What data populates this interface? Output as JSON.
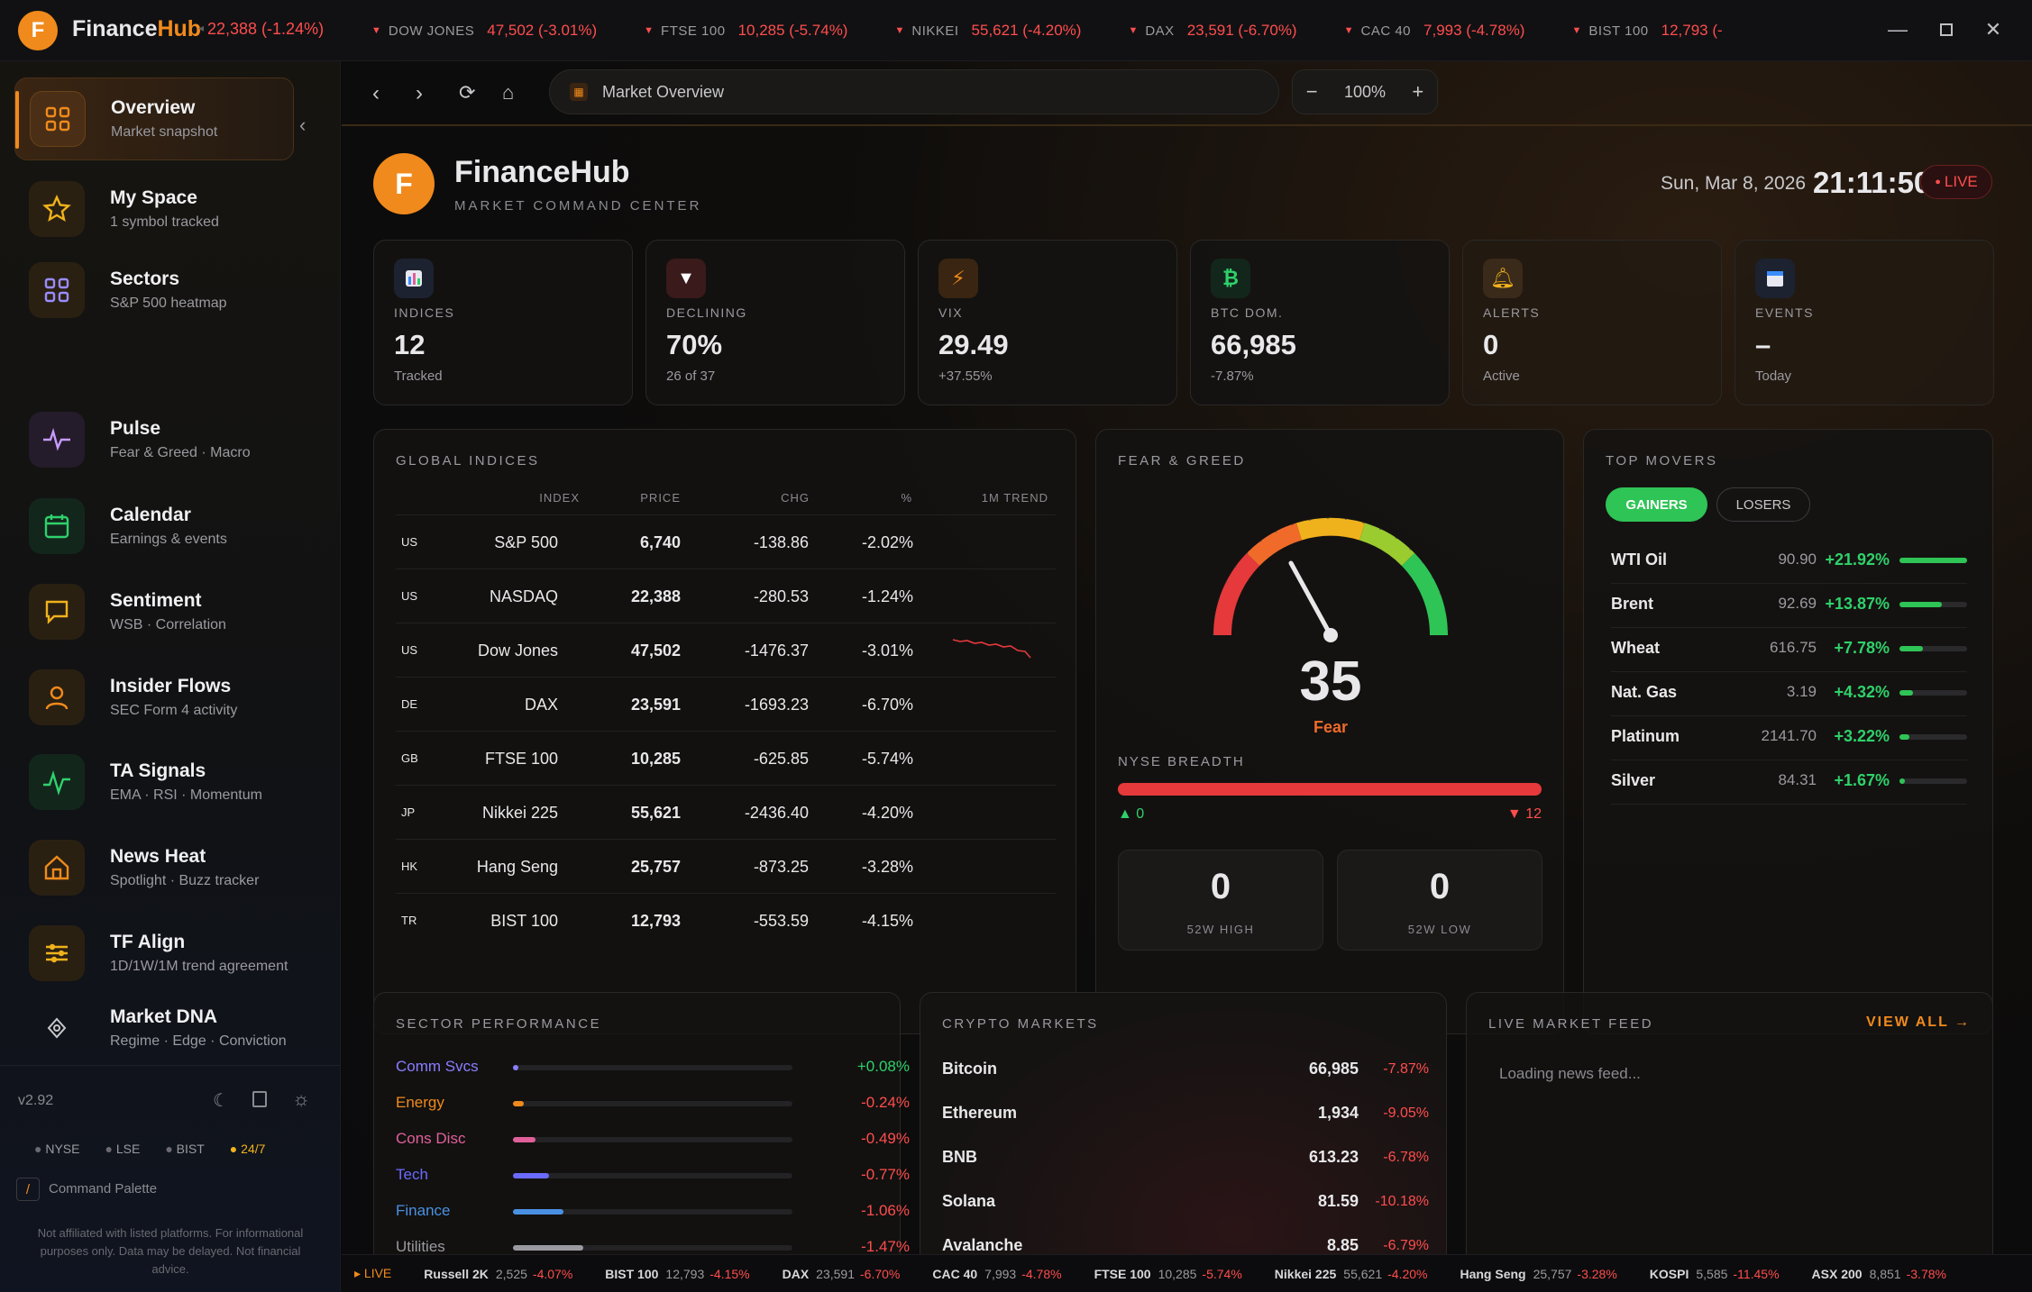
{
  "app": {
    "logo_letter": "F",
    "name_part1": "Finance",
    "name_part2": "Hub"
  },
  "ticker_first": "22,388 (-1.24%)",
  "ticker": [
    {
      "name": "DOW JONES",
      "value": "47,502 (-3.01%)"
    },
    {
      "name": "FTSE 100",
      "value": "10,285 (-5.74%)"
    },
    {
      "name": "NIKKEI",
      "value": "55,621 (-4.20%)"
    },
    {
      "name": "DAX",
      "value": "23,591 (-6.70%)"
    },
    {
      "name": "CAC 40",
      "value": "7,993 (-4.78%)"
    },
    {
      "name": "BIST 100",
      "value": "12,793 (-"
    }
  ],
  "sidebar": {
    "items": [
      {
        "title": "Overview",
        "sub": "Market snapshot"
      },
      {
        "title": "My Space",
        "sub": "1 symbol tracked"
      },
      {
        "title": "Sectors",
        "sub": "S&P 500 heatmap"
      },
      {
        "title": "Pulse",
        "sub": "Fear & Greed · Macro"
      },
      {
        "title": "Calendar",
        "sub": "Earnings & events"
      },
      {
        "title": "Sentiment",
        "sub": "WSB · Correlation"
      },
      {
        "title": "Insider Flows",
        "sub": "SEC Form 4 activity"
      },
      {
        "title": "TA Signals",
        "sub": "EMA · RSI · Momentum"
      },
      {
        "title": "News Heat",
        "sub": "Spotlight · Buzz tracker"
      },
      {
        "title": "TF Align",
        "sub": "1D/1W/1M trend agreement"
      },
      {
        "title": "Market DNA",
        "sub": "Regime · Edge · Conviction"
      }
    ],
    "version": "v2.92",
    "markets": [
      "NYSE",
      "LSE",
      "BIST",
      "24/7"
    ],
    "command_key": "/",
    "command_label": "Command Palette",
    "disclaimer": "Not affiliated with listed platforms. For informational purposes only. Data may be delayed. Not financial advice."
  },
  "browser": {
    "url": "Market Overview",
    "zoom": "100%"
  },
  "header": {
    "logo_letter": "F",
    "title": "FinanceHub",
    "subtitle": "MARKET COMMAND CENTER",
    "date": "Sun, Mar 8, 2026",
    "time": "21:11:50",
    "live": "LIVE"
  },
  "stats": [
    {
      "label": "INDICES",
      "value": "12",
      "sub": "Tracked",
      "color": "#9a9aa0"
    },
    {
      "label": "DECLINING",
      "value": "70%",
      "sub": "26 of 37",
      "color": "#ff4d4d"
    },
    {
      "label": "VIX",
      "value": "29.49",
      "sub": "+37.55%",
      "color": "#f08a1c"
    },
    {
      "label": "BTC DOM.",
      "value": "66,985",
      "sub": "-7.87%",
      "color": "#2fd16b"
    },
    {
      "label": "ALERTS",
      "value": "0",
      "sub": "Active",
      "color": "#9a9aa0"
    },
    {
      "label": "EVENTS",
      "value": "–",
      "sub": "Today",
      "color": "#9a9aa0"
    }
  ],
  "global": {
    "title": "GLOBAL INDICES",
    "headers": [
      "INDEX",
      "PRICE",
      "CHG",
      "%",
      "1M TREND"
    ],
    "rows": [
      {
        "cc": "US",
        "name": "S&P 500",
        "price": "6,740",
        "chg": "-138.86",
        "pct": "-2.02%"
      },
      {
        "cc": "US",
        "name": "NASDAQ",
        "price": "22,388",
        "chg": "-280.53",
        "pct": "-1.24%"
      },
      {
        "cc": "US",
        "name": "Dow Jones",
        "price": "47,502",
        "chg": "-1476.37",
        "pct": "-3.01%"
      },
      {
        "cc": "DE",
        "name": "DAX",
        "price": "23,591",
        "chg": "-1693.23",
        "pct": "-6.70%"
      },
      {
        "cc": "GB",
        "name": "FTSE 100",
        "price": "10,285",
        "chg": "-625.85",
        "pct": "-5.74%"
      },
      {
        "cc": "JP",
        "name": "Nikkei 225",
        "price": "55,621",
        "chg": "-2436.40",
        "pct": "-4.20%"
      },
      {
        "cc": "HK",
        "name": "Hang Seng",
        "price": "25,757",
        "chg": "-873.25",
        "pct": "-3.28%"
      },
      {
        "cc": "TR",
        "name": "BIST 100",
        "price": "12,793",
        "chg": "-553.59",
        "pct": "-4.15%"
      }
    ]
  },
  "fear": {
    "title": "FEAR & GREED",
    "value": "35",
    "label": "Fear",
    "breadth_title": "NYSE BREADTH",
    "adv": "0",
    "dec": "12",
    "high_val": "0",
    "high_lbl": "52W HIGH",
    "low_val": "0",
    "low_lbl": "52W LOW"
  },
  "movers": {
    "title": "TOP MOVERS",
    "tab_gainers": "GAINERS",
    "tab_losers": "LOSERS",
    "rows": [
      {
        "name": "WTI Oil",
        "price": "90.90",
        "pct": "+21.92%",
        "level": 1.0
      },
      {
        "name": "Brent",
        "price": "92.69",
        "pct": "+13.87%",
        "level": 0.63
      },
      {
        "name": "Wheat",
        "price": "616.75",
        "pct": "+7.78%",
        "level": 0.35
      },
      {
        "name": "Nat. Gas",
        "price": "3.19",
        "pct": "+4.32%",
        "level": 0.2
      },
      {
        "name": "Platinum",
        "price": "2141.70",
        "pct": "+3.22%",
        "level": 0.15
      },
      {
        "name": "Silver",
        "price": "84.31",
        "pct": "+1.67%",
        "level": 0.08
      }
    ]
  },
  "sectors": {
    "title": "SECTOR PERFORMANCE",
    "rows": [
      {
        "name": "Comm Svcs",
        "pct": "+0.08%",
        "color": "#8a7dff",
        "level": 0.02
      },
      {
        "name": "Energy",
        "pct": "-0.24%",
        "color": "#f08a1c",
        "level": 0.04
      },
      {
        "name": "Cons Disc",
        "pct": "-0.49%",
        "color": "#e0609a",
        "level": 0.08
      },
      {
        "name": "Tech",
        "pct": "-0.77%",
        "color": "#6a6aff",
        "level": 0.13
      },
      {
        "name": "Finance",
        "pct": "-1.06%",
        "color": "#4a90e2",
        "level": 0.18
      },
      {
        "name": "Utilities",
        "pct": "-1.47%",
        "color": "#9a9aa0",
        "level": 0.25
      }
    ]
  },
  "crypto": {
    "title": "CRYPTO MARKETS",
    "rows": [
      {
        "name": "Bitcoin",
        "price": "66,985",
        "pct": "-7.87%"
      },
      {
        "name": "Ethereum",
        "price": "1,934",
        "pct": "-9.05%"
      },
      {
        "name": "BNB",
        "price": "613.23",
        "pct": "-6.78%"
      },
      {
        "name": "Solana",
        "price": "81.59",
        "pct": "-10.18%"
      },
      {
        "name": "Avalanche",
        "price": "8.85",
        "pct": "-6.79%"
      }
    ]
  },
  "feed": {
    "title": "LIVE MARKET FEED",
    "view_all": "VIEW ALL →",
    "loading": "Loading news feed..."
  },
  "bottom_ticker": {
    "live": "▸ LIVE",
    "items": [
      {
        "n": "Russell 2K",
        "p": "2,525",
        "c": "-4.07%"
      },
      {
        "n": "BIST 100",
        "p": "12,793",
        "c": "-4.15%"
      },
      {
        "n": "DAX",
        "p": "23,591",
        "c": "-6.70%"
      },
      {
        "n": "CAC 40",
        "p": "7,993",
        "c": "-4.78%"
      },
      {
        "n": "FTSE 100",
        "p": "10,285",
        "c": "-5.74%"
      },
      {
        "n": "Nikkei 225",
        "p": "55,621",
        "c": "-4.20%"
      },
      {
        "n": "Hang Seng",
        "p": "25,757",
        "c": "-3.28%"
      },
      {
        "n": "KOSPI",
        "p": "5,585",
        "c": "-11.45%"
      },
      {
        "n": "ASX 200",
        "p": "8,851",
        "c": "-3.78%"
      }
    ]
  }
}
